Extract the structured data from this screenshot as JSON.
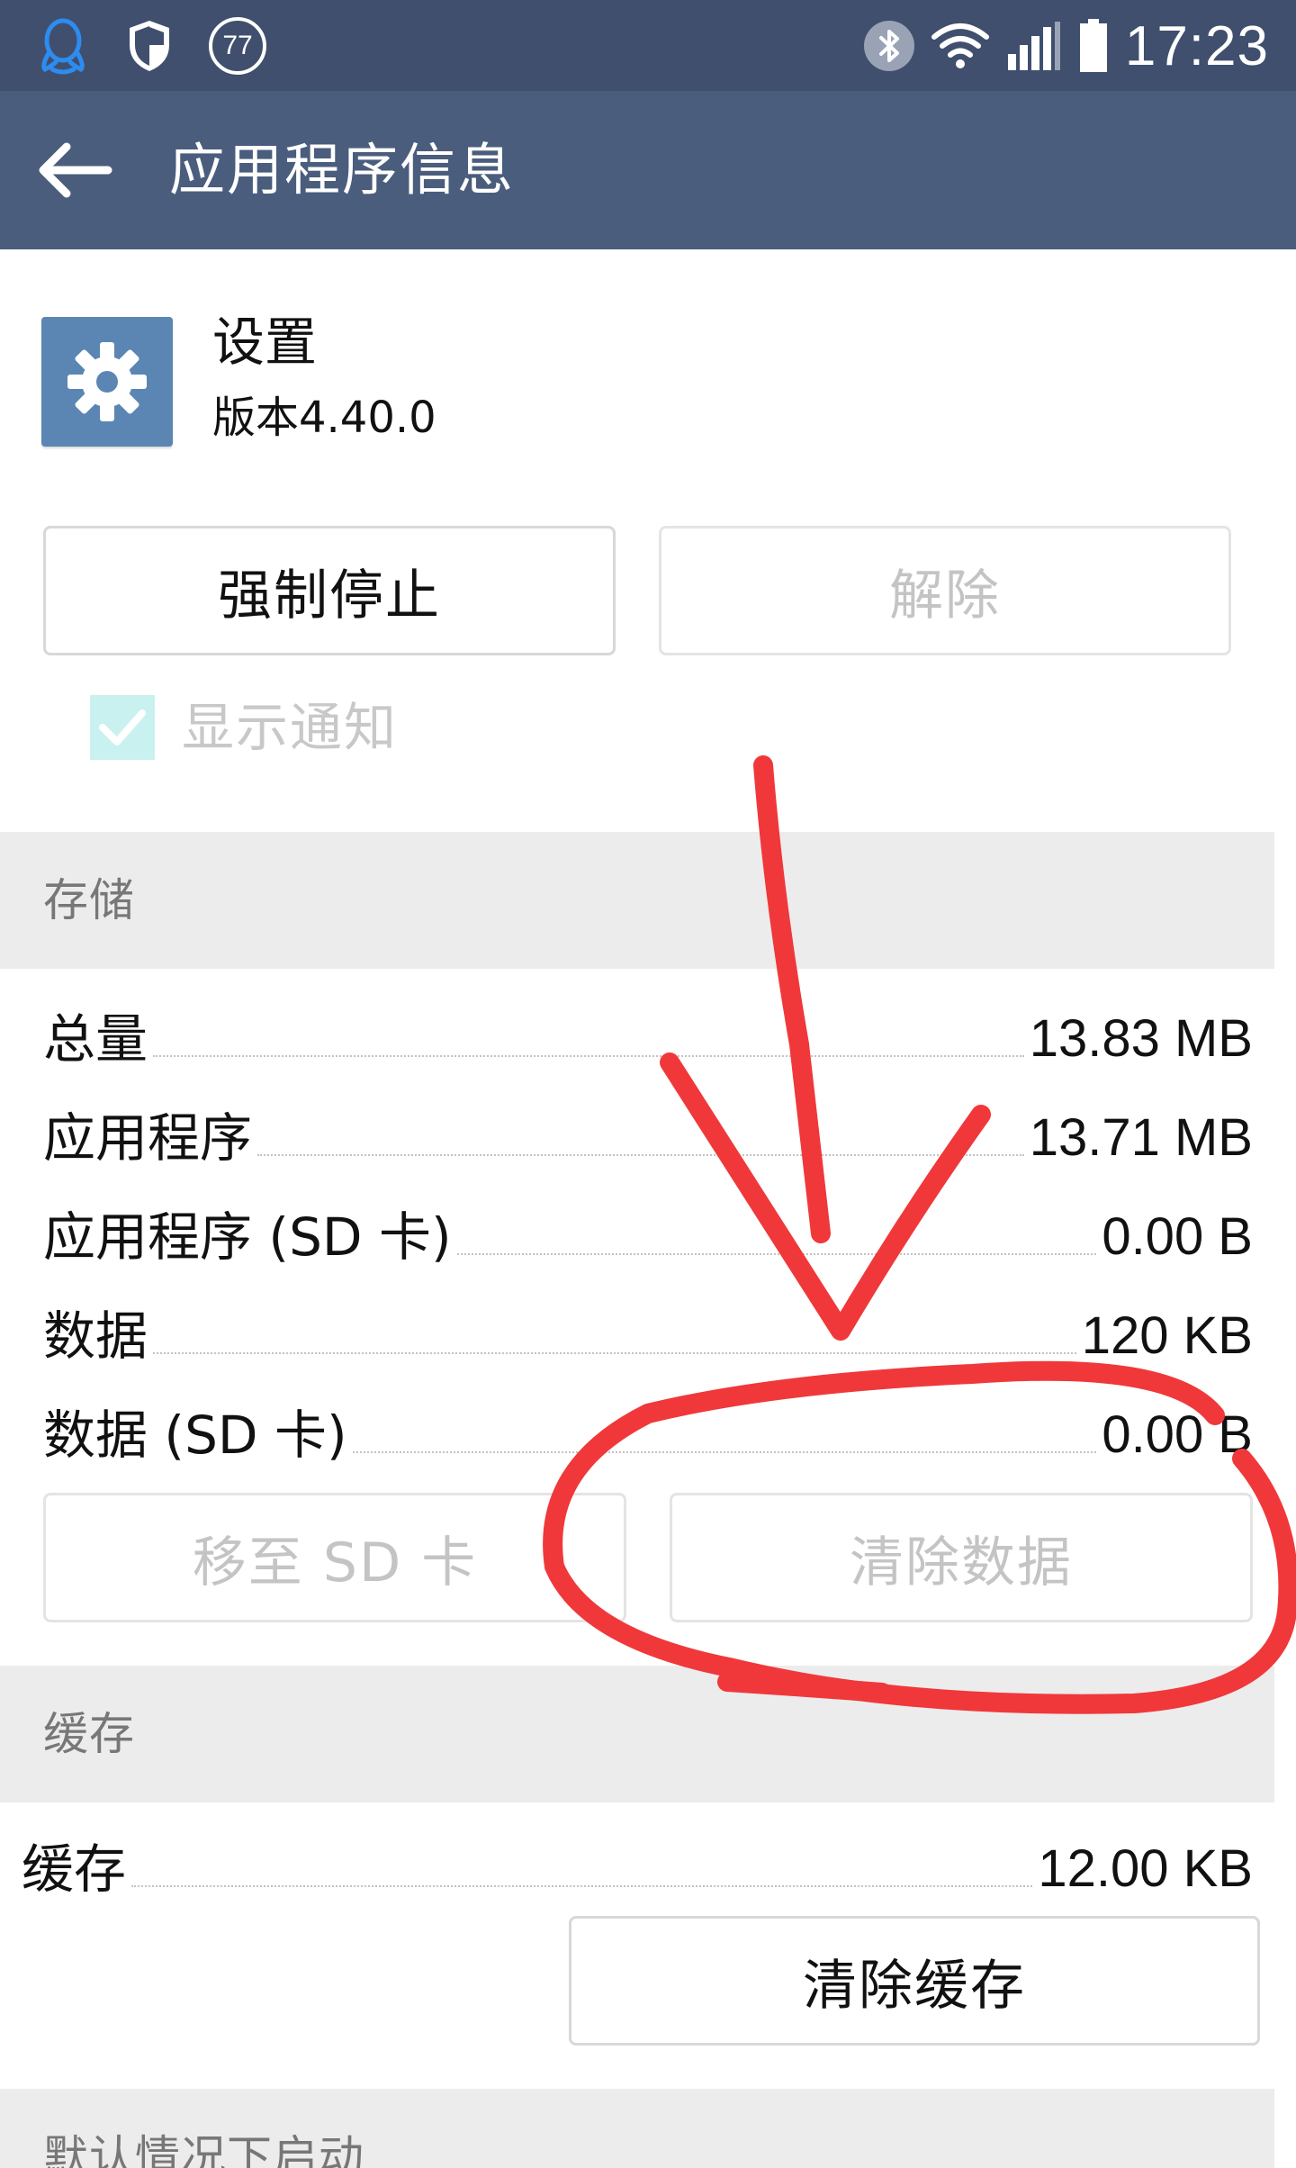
{
  "status_bar": {
    "time": "17:23",
    "notification_badge": "77",
    "left_icons": [
      "qq-icon",
      "shield-icon",
      "badge-77-icon"
    ],
    "right_icons": [
      "bluetooth-icon",
      "wifi-icon",
      "signal-icon",
      "battery-icon"
    ]
  },
  "app_bar": {
    "title": "应用程序信息",
    "back_icon": "arrow-left-icon"
  },
  "app_info": {
    "name": "设置",
    "version": "版本4.40.0",
    "icon": "gear-icon"
  },
  "actions": {
    "force_stop": "强制停止",
    "uninstall": "解除"
  },
  "notification": {
    "label": "显示通知",
    "checked": true
  },
  "storage": {
    "header": "存储",
    "rows": [
      {
        "label": "总量",
        "value": "13.83 MB"
      },
      {
        "label": "应用程序",
        "value": "13.71 MB"
      },
      {
        "label": "应用程序 (SD 卡)",
        "value": "0.00 B"
      },
      {
        "label": "数据",
        "value": "120 KB"
      },
      {
        "label": "数据 (SD 卡)",
        "value": "0.00 B"
      }
    ],
    "move_to_sd": "移至 SD 卡",
    "clear_data": "清除数据"
  },
  "cache": {
    "header": "缓存",
    "label": "缓存",
    "value": "12.00 KB",
    "clear_cache": "清除缓存"
  },
  "launch_defaults": {
    "header": "默认情况下启动"
  },
  "colors": {
    "status_bar": "#404f6d",
    "app_bar": "#4b5d7d",
    "annotation": "#f0383a",
    "section_bg": "#ececec"
  }
}
